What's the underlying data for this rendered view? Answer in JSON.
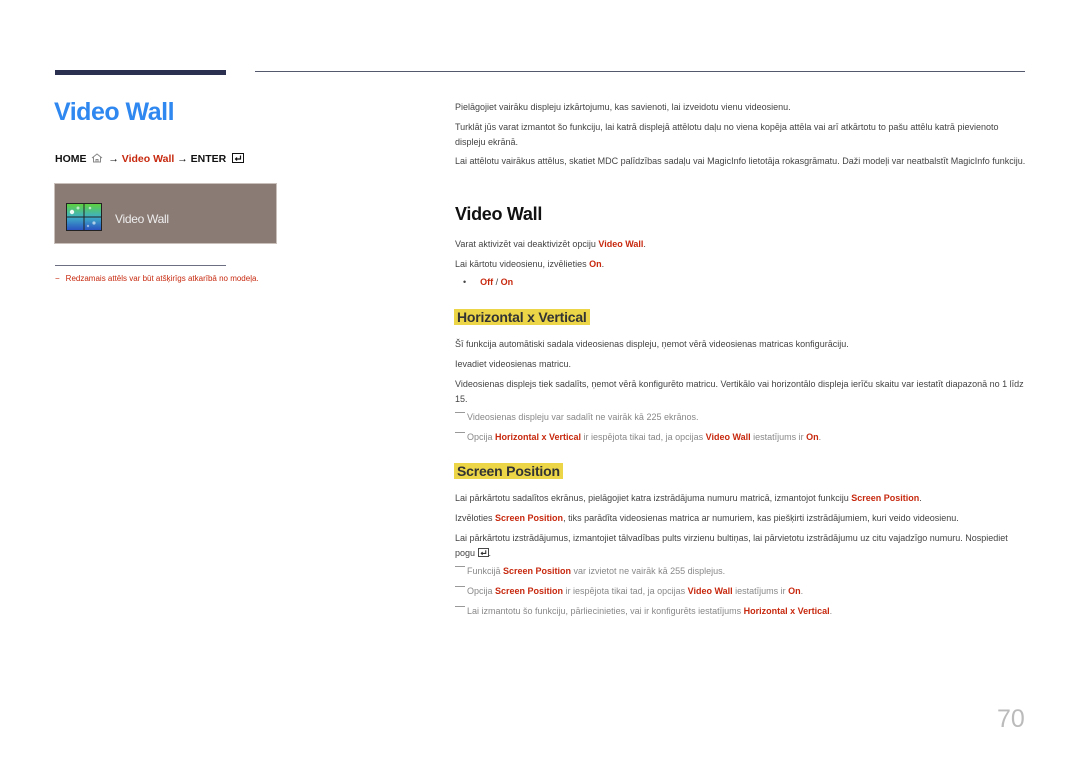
{
  "page": {
    "title": "Video Wall",
    "page_number": "70"
  },
  "breadcrumb": {
    "home": "HOME",
    "arrow1": "→",
    "item": "Video Wall",
    "arrow2": "→",
    "enter": "ENTER"
  },
  "preview": {
    "label": "Video Wall",
    "icon": "video-wall-icon"
  },
  "footnote": {
    "dash": "−",
    "text": "Redzamais attēls var būt atšķirīgs atkarībā no modeļa."
  },
  "intro": {
    "p1": "Pielāgojiet vairāku displeju izkārtojumu, kas savienoti, lai izveidotu vienu videosienu.",
    "p2": "Turklāt jūs varat izmantot šo funkciju, lai katrā displejā attēlotu daļu no viena kopēja attēla vai arī atkārtotu to pašu attēlu katrā pievienoto displeju ekrānā.",
    "p3": "Lai attēlotu vairākus attēlus, skatiet MDC palīdzības sadaļu vai MagicInfo lietotāja rokasgrāmatu. Daži modeļi var neatbalstīt MagicInfo funkciju."
  },
  "video_wall_section": {
    "heading": "Video Wall",
    "p1_pre": "Varat aktivizēt vai deaktivizēt opciju ",
    "p1_hl": "Video Wall",
    "p1_post": ".",
    "p2_pre": "Lai kārtotu videosienu, izvēlieties ",
    "p2_hl": "On",
    "p2_post": ".",
    "bullet": "•",
    "opt_off": "Off",
    "opt_sep": " / ",
    "opt_on": "On"
  },
  "hxv_section": {
    "heading": "Horizontal x Vertical",
    "p1": "Šī funkcija automātiski sadala videosienas displeju, ņemot vērā videosienas matricas konfigurāciju.",
    "p2": "Ievadiet videosienas matricu.",
    "p3": "Videosienas displejs tiek sadalīts, ņemot vērā konfigurēto matricu. Vertikālo vai horizontālo displeja ierīču skaitu var iestatīt diapazonā no 1 līdz 15.",
    "note1": "Videosienas displeju var sadalīt ne vairāk kā 225 ekrānos.",
    "note2_a": "Opcija ",
    "note2_b": "Horizontal x Vertical",
    "note2_c": " ir iespējota tikai tad, ja opcijas ",
    "note2_d": "Video Wall",
    "note2_e": " iestatījums ir ",
    "note2_f": "On",
    "note2_g": "."
  },
  "screen_position_section": {
    "heading": "Screen Position",
    "p1_pre": "Lai pārkārtotu sadalītos ekrānus, pielāgojiet katra izstrādājuma numuru matricā, izmantojot funkciju ",
    "p1_hl": "Screen Position",
    "p1_post": ".",
    "p2_pre": "Izvēloties ",
    "p2_hl": "Screen Position",
    "p2_post": ", tiks parādīta videosienas matrica ar numuriem, kas piešķirti izstrādājumiem, kuri veido videosienu.",
    "p3_pre": "Lai pārkārtotu izstrādājumus, izmantojiet tālvadības pults virzienu bultiņas, lai pārvietotu izstrādājumu uz citu vajadzīgo numuru. Nospiediet pogu ",
    "p3_post": ".",
    "note1_a": "Funkcijā ",
    "note1_b": "Screen Position",
    "note1_c": " var izvietot ne vairāk kā 255 displejus.",
    "note2_a": "Opcija ",
    "note2_b": "Screen Position",
    "note2_c": " ir iespējota tikai tad, ja opcijas ",
    "note2_d": "Video Wall",
    "note2_e": " iestatījums ir ",
    "note2_f": "On",
    "note2_g": ".",
    "note3_a": "Lai izmantotu šo funkciju, pārliecinieties, vai ir konfigurēts iestatījums ",
    "note3_b": "Horizontal x Vertical",
    "note3_c": "."
  },
  "colors": {
    "title_blue": "#2f87f0",
    "highlight_red": "#c7290f",
    "heading_yellow": "#ecd648",
    "panel_bg": "#8b7b75"
  }
}
